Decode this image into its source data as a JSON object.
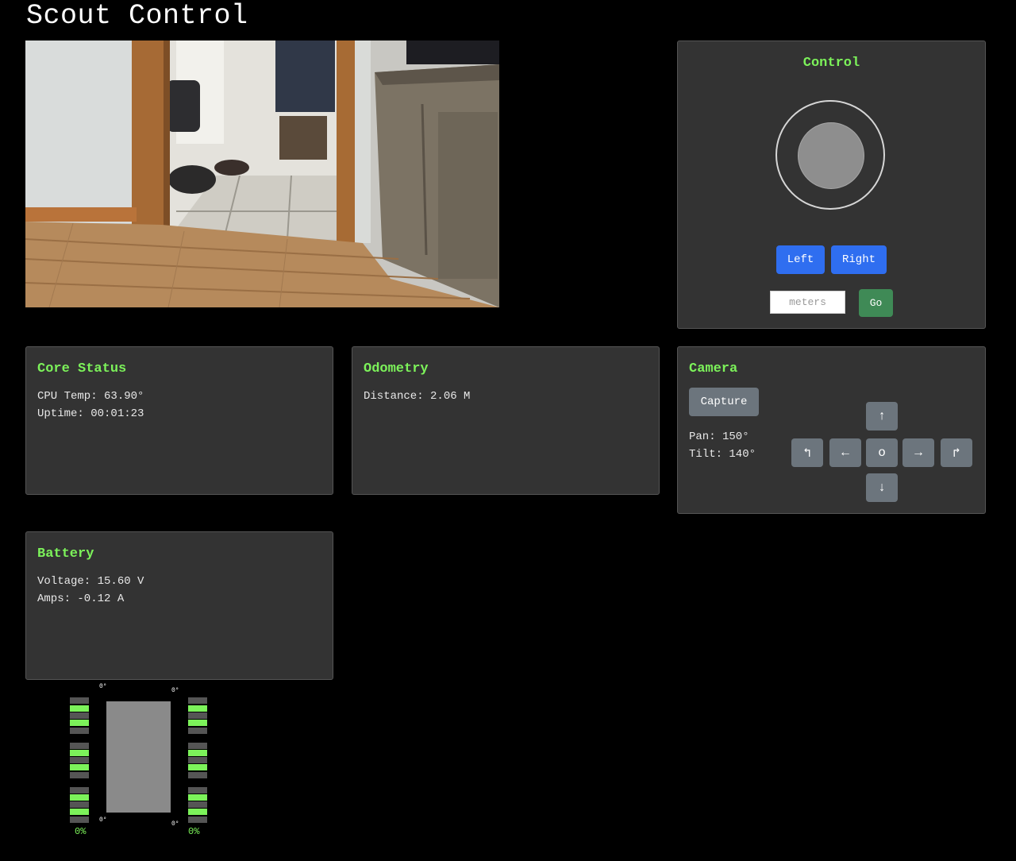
{
  "app": {
    "title": "Scout Control"
  },
  "control": {
    "title": "Control",
    "left_label": "Left",
    "right_label": "Right",
    "meters_placeholder": "meters",
    "go_label": "Go"
  },
  "core_status": {
    "title": "Core Status",
    "cpu_temp": "CPU Temp: 63.90°",
    "uptime": "Uptime: 00:01:23"
  },
  "odometry": {
    "title": "Odometry",
    "distance": "Distance: 2.06 M"
  },
  "camera": {
    "title": "Camera",
    "capture_label": "Capture",
    "pan": "Pan: 150°",
    "tilt": "Tilt: 140°",
    "buttons": {
      "up": "↑",
      "down": "↓",
      "left": "←",
      "right": "→",
      "center": "o",
      "turn_left": "↰",
      "turn_right": "↱"
    }
  },
  "battery": {
    "title": "Battery",
    "voltage": "Voltage: 15.60 V",
    "amps": "Amps: -0.12 A"
  },
  "motor_gauge": {
    "left_top_angle": "0°",
    "right_top_angle": "0°",
    "left_bottom_angle": "0°",
    "right_bottom_angle": "0°",
    "left_percent": "0%",
    "right_percent": "0%",
    "active_color": "#7cf25a",
    "inactive_color": "#555555"
  },
  "colors": {
    "accent": "#7cf25a",
    "primary_button": "#2f6ef0",
    "go_button": "#3f8a56",
    "secondary_button": "#6c757d",
    "panel_bg": "#333333"
  }
}
